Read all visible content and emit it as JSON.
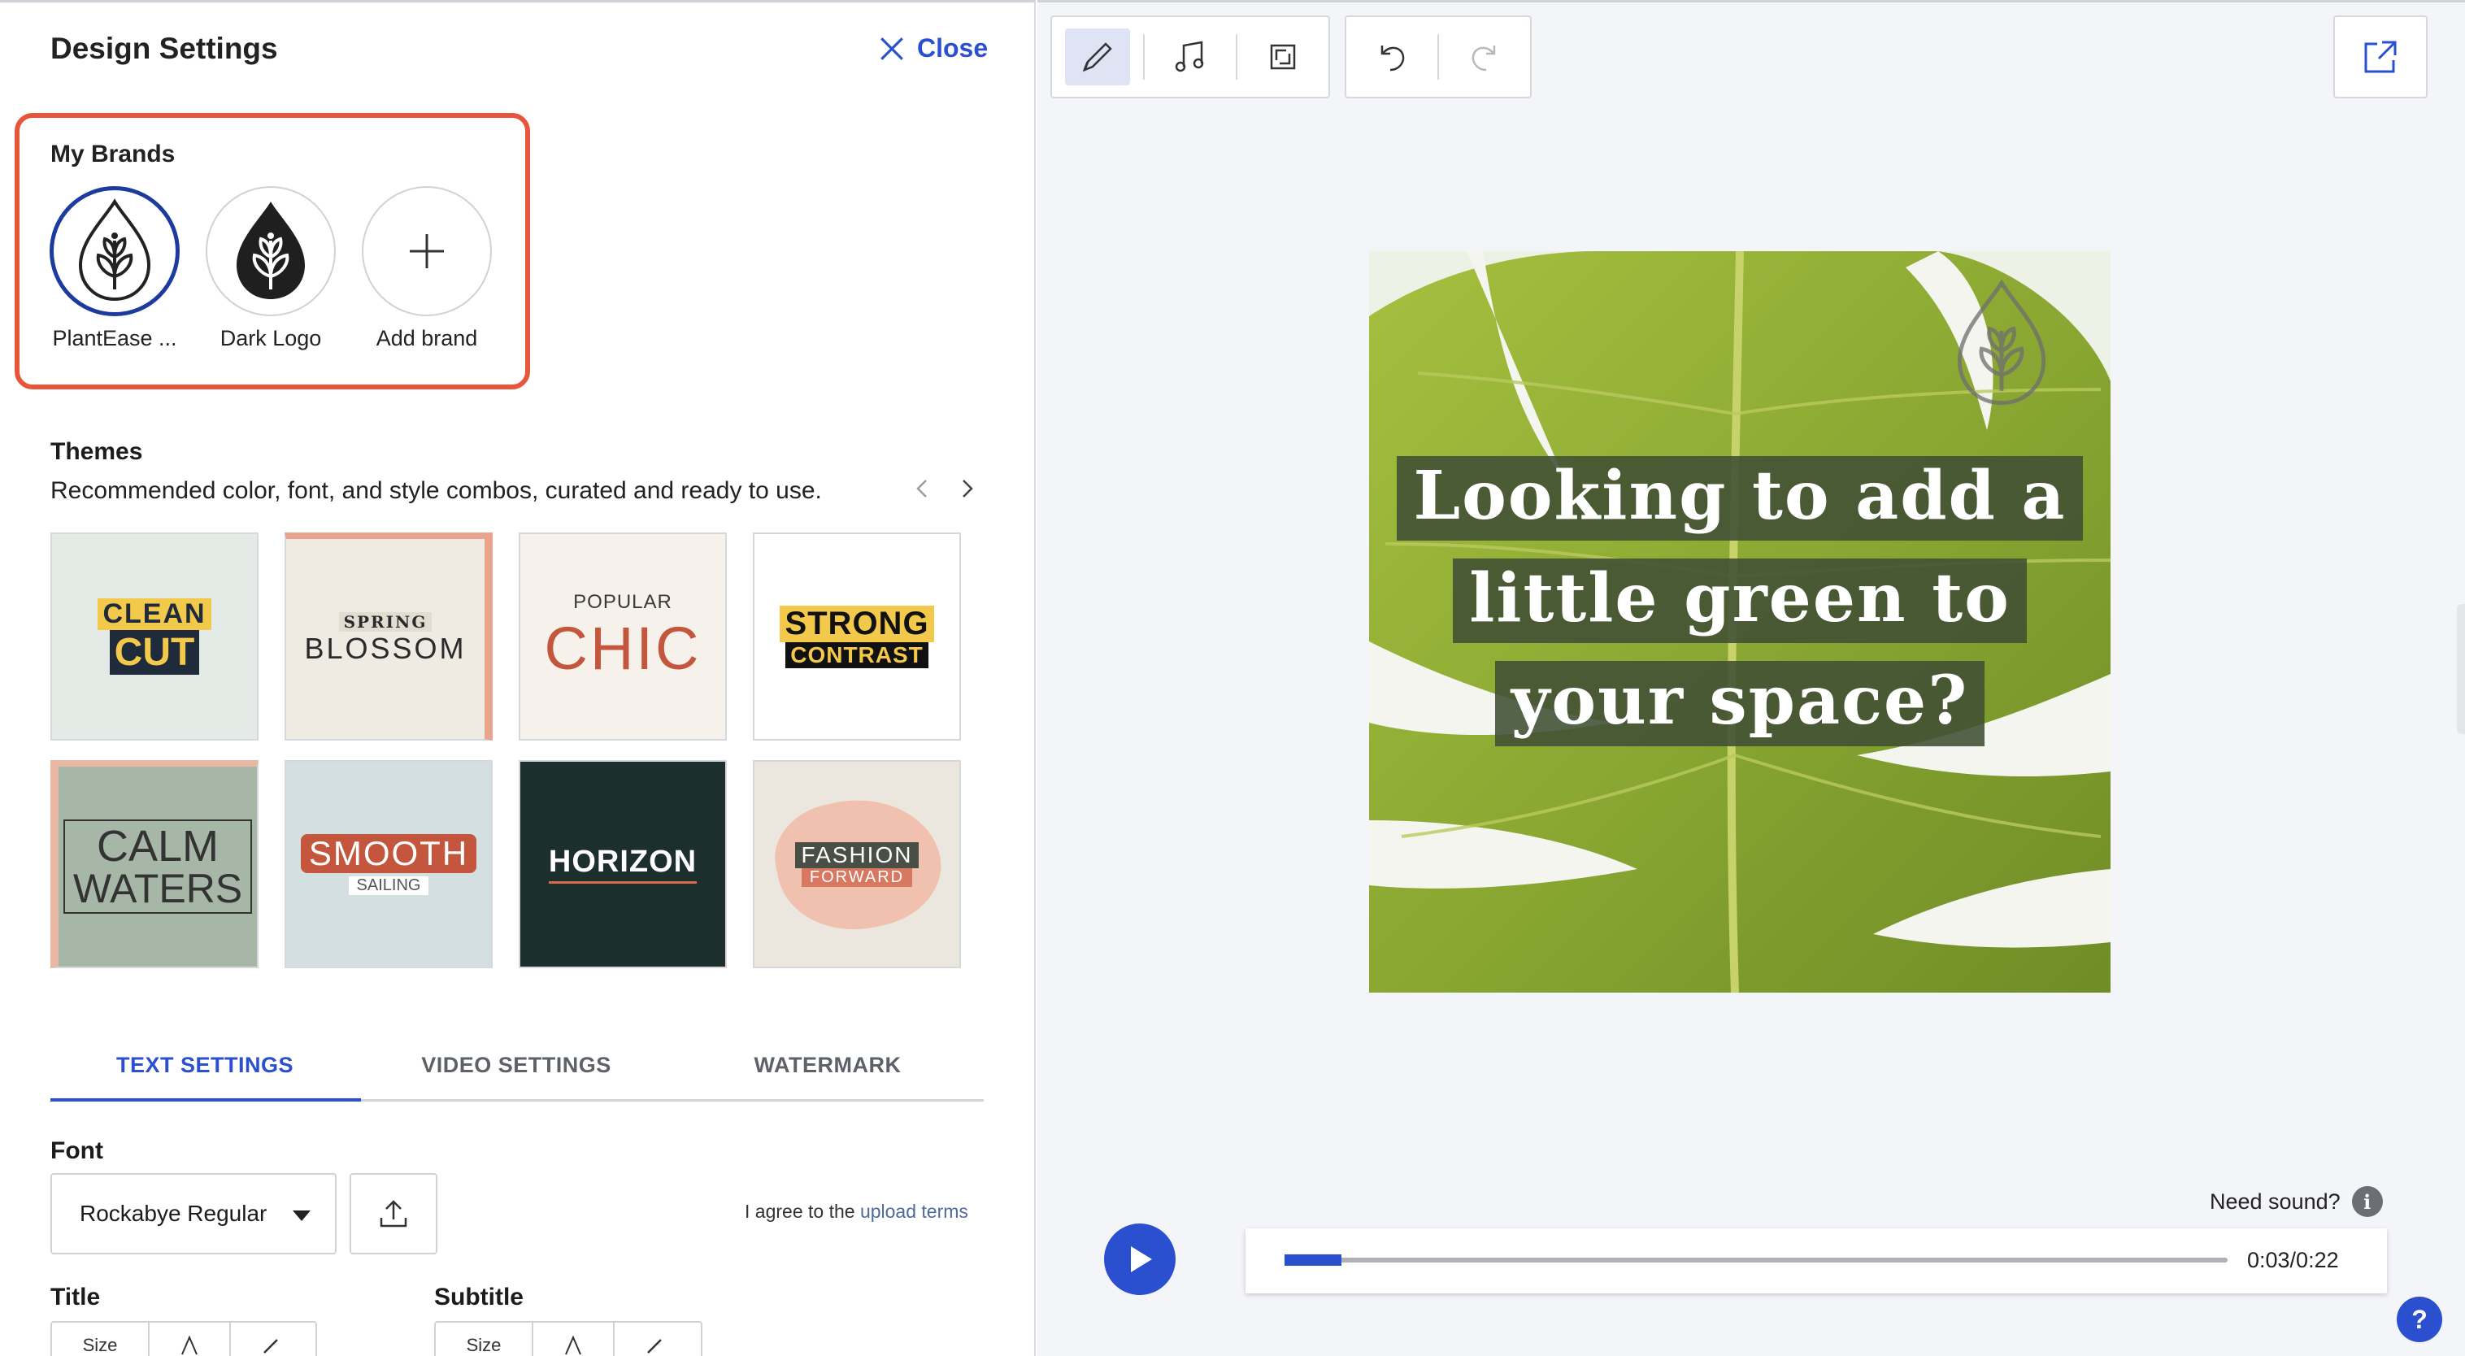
{
  "panel": {
    "title": "Design Settings",
    "close_label": "Close"
  },
  "brands": {
    "title": "My Brands",
    "items": [
      {
        "label": "PlantEase ...",
        "selected": true,
        "style": "light"
      },
      {
        "label": "Dark Logo",
        "selected": false,
        "style": "dark"
      },
      {
        "label": "Add brand",
        "selected": false,
        "style": "add"
      }
    ]
  },
  "themes": {
    "title": "Themes",
    "description": "Recommended color, font, and style combos, curated and ready to use.",
    "cards": [
      {
        "line1": "CLEAN",
        "line2": "CUT"
      },
      {
        "line1": "SPRING",
        "line2": "BLOSSOM"
      },
      {
        "line1": "POPULAR",
        "line2": "CHIC"
      },
      {
        "line1": "STRONG",
        "line2": "CONTRAST"
      },
      {
        "line1": "CALM",
        "line2": "WATERS"
      },
      {
        "line1": "SMOOTH",
        "line2": "SAILING"
      },
      {
        "line1": "HORIZON"
      },
      {
        "line1": "FASHION",
        "line2": "FORWARD"
      }
    ]
  },
  "tabs": [
    {
      "label": "TEXT SETTINGS",
      "active": true
    },
    {
      "label": "VIDEO SETTINGS",
      "active": false
    },
    {
      "label": "WATERMARK",
      "active": false
    }
  ],
  "font": {
    "label": "Font",
    "selected": "Rockabye Regular",
    "agree_text": "I agree to the ",
    "agree_link": "upload terms"
  },
  "title_settings": {
    "label": "Title",
    "size_label": "Size"
  },
  "subtitle_settings": {
    "label": "Subtitle",
    "size_label": "Size"
  },
  "preview": {
    "lines": [
      "Looking to add a",
      "little green to",
      "your space?"
    ]
  },
  "player": {
    "need_sound": "Need sound?",
    "time": "0:03/0:22",
    "progress_fraction": 0.06
  },
  "colors": {
    "accent": "#2a4fcf",
    "highlight_border": "#e8553d"
  }
}
